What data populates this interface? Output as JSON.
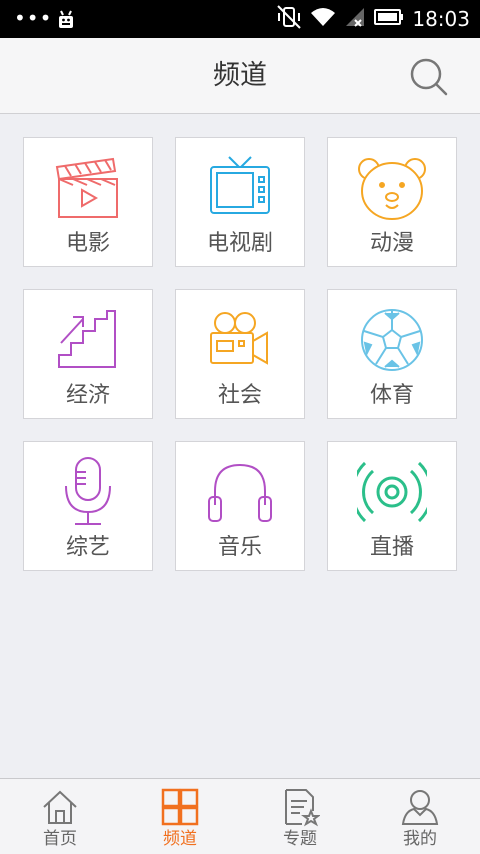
{
  "status_bar": {
    "time": "18:03",
    "overflow_dots": "•••"
  },
  "header": {
    "title": "频道"
  },
  "channels": [
    {
      "label": "电影",
      "icon": "clapperboard-icon",
      "color": "#ef6b6b"
    },
    {
      "label": "电视剧",
      "icon": "tv-icon",
      "color": "#27a9e1"
    },
    {
      "label": "动漫",
      "icon": "bear-icon",
      "color": "#f5a623"
    },
    {
      "label": "经济",
      "icon": "stairs-icon",
      "color": "#b14fc5"
    },
    {
      "label": "社会",
      "icon": "video-camera-icon",
      "color": "#f5a623"
    },
    {
      "label": "体育",
      "icon": "soccer-ball-icon",
      "color": "#6ac3e6"
    },
    {
      "label": "综艺",
      "icon": "microphone-icon",
      "color": "#b14fc5"
    },
    {
      "label": "音乐",
      "icon": "headphones-icon",
      "color": "#b14fc5"
    },
    {
      "label": "直播",
      "icon": "broadcast-icon",
      "color": "#2bbf8a"
    }
  ],
  "tabs": [
    {
      "label": "首页",
      "icon": "home-icon",
      "active": false
    },
    {
      "label": "频道",
      "icon": "grid-icon",
      "active": true
    },
    {
      "label": "专题",
      "icon": "document-star-icon",
      "active": false
    },
    {
      "label": "我的",
      "icon": "user-icon",
      "active": false
    }
  ],
  "colors": {
    "accent": "#f1701f",
    "tab_inactive": "#777777",
    "background": "#eeeff3"
  }
}
